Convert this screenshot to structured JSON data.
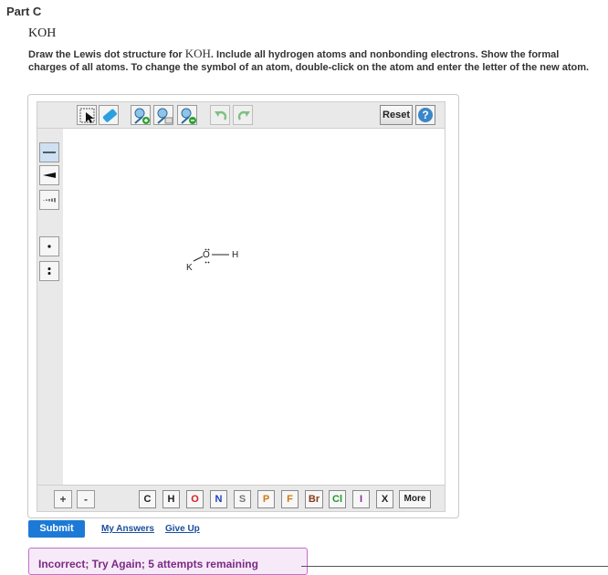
{
  "part_title": "Part C",
  "question_name": "KOH",
  "instructions": {
    "before": "Draw the Lewis dot structure for ",
    "formula": "KOH",
    "after": ". Include all hydrogen atoms and nonbonding electrons. Show the formal charges of all atoms. To change the symbol of an atom, double-click on the atom and enter the letter of the new atom."
  },
  "toolbar": {
    "icons": [
      "select-tool-icon",
      "eraser-icon",
      "zoom-in-icon",
      "zoom-reset-icon",
      "zoom-out-icon",
      "undo-icon",
      "redo-icon"
    ],
    "reset_label": "Reset",
    "help_label": "?"
  },
  "sidebar": {
    "tools": [
      "single-bond-icon",
      "wedge-bond-icon",
      "hash-bond-icon",
      "single-electron-icon",
      "electron-pair-icon"
    ]
  },
  "molecule": {
    "atoms": [
      "K",
      "O",
      "H"
    ]
  },
  "bottombar": {
    "plus_label": "+",
    "minus_label": "-",
    "elements": [
      {
        "symbol": "C",
        "color": "#222222"
      },
      {
        "symbol": "H",
        "color": "#222222"
      },
      {
        "symbol": "O",
        "color": "#d62020"
      },
      {
        "symbol": "N",
        "color": "#2040c0"
      },
      {
        "symbol": "S",
        "color": "#777777"
      },
      {
        "symbol": "P",
        "color": "#d07a10"
      },
      {
        "symbol": "F",
        "color": "#d07a10"
      },
      {
        "symbol": "Br",
        "color": "#8a3a1a"
      },
      {
        "symbol": "Cl",
        "color": "#1a9a2a"
      },
      {
        "symbol": "I",
        "color": "#8a2aa0"
      },
      {
        "symbol": "X",
        "color": "#222222"
      }
    ],
    "more_label": "More"
  },
  "actions": {
    "submit_label": "Submit",
    "my_answers_label": "My Answers",
    "give_up_label": "Give Up"
  },
  "feedback": {
    "text": "Incorrect; Try Again; 5 attempts remaining"
  },
  "colors": {
    "accent": "#1c7ad6",
    "link": "#1a4e9c",
    "feedback_border": "#c36ecc",
    "feedback_bg": "#f7eaf8"
  }
}
